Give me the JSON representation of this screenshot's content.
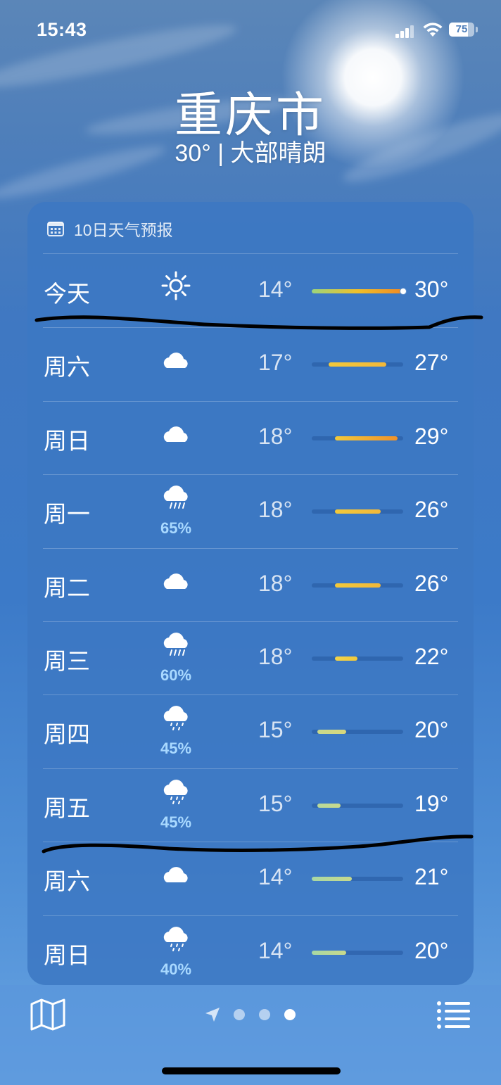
{
  "status_bar": {
    "time": "15:43",
    "battery": "75",
    "battery_fraction": 0.75
  },
  "header": {
    "city": "重庆市",
    "summary": "30° | 大部晴朗"
  },
  "forecast": {
    "title": "10日天气预报",
    "days": [
      {
        "day": "今天",
        "icon": "sun-icon",
        "precip": "",
        "low": "14°",
        "high": "30°",
        "low_val": 14,
        "high_val": 30,
        "colors": [
          "#9bd47c",
          "#f0c02a",
          "#f08a24"
        ],
        "current_val": 30
      },
      {
        "day": "周六",
        "icon": "cloud-icon",
        "precip": "",
        "low": "17°",
        "high": "27°",
        "low_val": 17,
        "high_val": 27,
        "colors": [
          "#f2c93a",
          "#f2b83a"
        ]
      },
      {
        "day": "周日",
        "icon": "cloud-icon",
        "precip": "",
        "low": "18°",
        "high": "29°",
        "low_val": 18,
        "high_val": 29,
        "colors": [
          "#f2c93a",
          "#f0922a"
        ]
      },
      {
        "day": "周一",
        "icon": "rain-cloud-icon",
        "precip": "65%",
        "low": "18°",
        "high": "26°",
        "low_val": 18,
        "high_val": 26,
        "colors": [
          "#f2c93a",
          "#f2b83a"
        ]
      },
      {
        "day": "周二",
        "icon": "cloud-icon",
        "precip": "",
        "low": "18°",
        "high": "26°",
        "low_val": 18,
        "high_val": 26,
        "colors": [
          "#f2c93a",
          "#f2b83a"
        ]
      },
      {
        "day": "周三",
        "icon": "rain-cloud-icon",
        "precip": "60%",
        "low": "18°",
        "high": "22°",
        "low_val": 18,
        "high_val": 22,
        "colors": [
          "#f2d44a",
          "#f2c93a"
        ]
      },
      {
        "day": "周四",
        "icon": "drizzle-cloud-icon",
        "precip": "45%",
        "low": "15°",
        "high": "20°",
        "low_val": 15,
        "high_val": 20,
        "colors": [
          "#c8d98c",
          "#d8d77c"
        ]
      },
      {
        "day": "周五",
        "icon": "drizzle-cloud-icon",
        "precip": "45%",
        "low": "15°",
        "high": "19°",
        "low_val": 15,
        "high_val": 19,
        "colors": [
          "#b8d99a",
          "#c8d98c"
        ]
      },
      {
        "day": "周六",
        "icon": "cloud-icon",
        "precip": "",
        "low": "14°",
        "high": "21°",
        "low_val": 14,
        "high_val": 21,
        "colors": [
          "#a8d8a4",
          "#c8d98c"
        ]
      },
      {
        "day": "周日",
        "icon": "drizzle-cloud-icon",
        "precip": "40%",
        "low": "14°",
        "high": "20°",
        "low_val": 14,
        "high_val": 20,
        "colors": [
          "#a8d8a4",
          "#c8d98c"
        ]
      }
    ],
    "scale_min": 14,
    "scale_max": 30
  },
  "bottom_bar": {
    "page_count": 3,
    "active_page": 2
  }
}
